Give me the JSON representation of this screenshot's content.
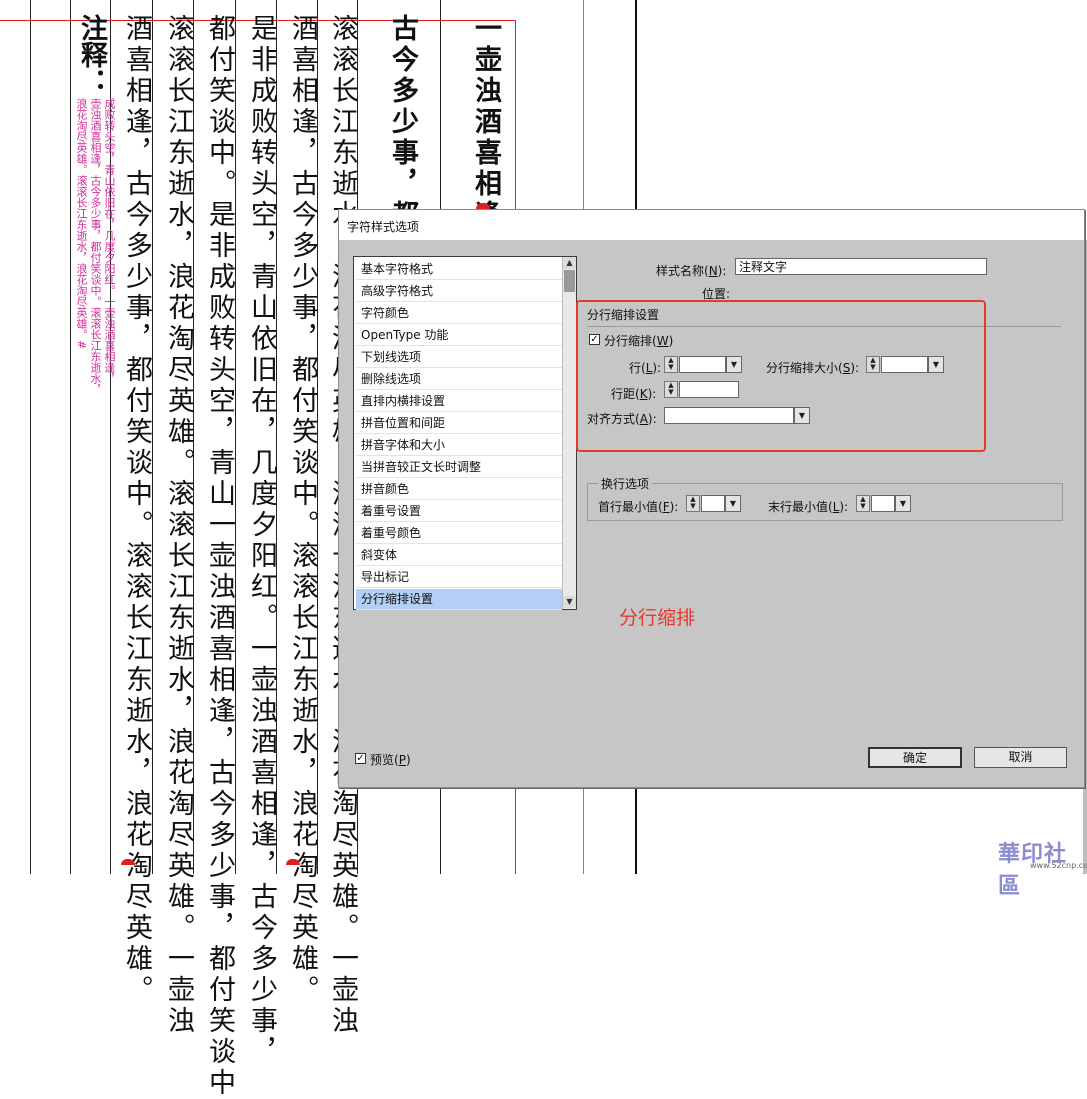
{
  "document": {
    "note_heading": "注释：",
    "note_text_col1": "成败转头空，青山依旧在，几度夕阳红。一壶浊酒喜相逢，",
    "note_text_col2": "壶浊酒喜相逢，古今多少事，都付笑谈中。滚滚长江东逝水，",
    "note_text_col3": "浪花淘尽英雄。滚滚长江东逝水，浪花淘尽英雄。#",
    "columns": [
      "酒喜相逢，古今多少事，都付笑谈中。滚滚长江东逝水，浪花淘尽英雄。",
      "滚滚长江东逝水，浪花淘尽英雄。滚滚长江东逝水，浪花淘尽英雄。一壶浊",
      "都付笑谈中。是非成败转头空，青山一壶浊酒喜相逢，古今多少事，都付笑谈中",
      "是非成败转头空，青山依旧在，几度夕阳红。一壶浊酒喜相逢，古今多少事，",
      "酒喜相逢，古今多少事，都付笑谈中。滚滚长江东逝水，浪花淘尽英雄。",
      "滚滚长江东逝水，浪花淘尽英雄。滚滚长江东逝水，浪花淘尽英雄。一壶浊"
    ],
    "bold_col1": "古今多少事，都付",
    "bold_col2": "一壶浊酒喜相逢，"
  },
  "dialog": {
    "title": "字符样式选项",
    "categories": [
      {
        "label": "基本字符格式"
      },
      {
        "label": "高级字符格式"
      },
      {
        "label": "字符颜色"
      },
      {
        "label": "OpenType 功能"
      },
      {
        "label": "下划线选项"
      },
      {
        "label": "删除线选项"
      },
      {
        "label": "直排内横排设置"
      },
      {
        "label": "拼音位置和间距"
      },
      {
        "label": "拼音字体和大小"
      },
      {
        "label": "当拼音较正文长时调整"
      },
      {
        "label": "拼音颜色"
      },
      {
        "label": "着重号设置"
      },
      {
        "label": "着重号颜色"
      },
      {
        "label": "斜变体"
      },
      {
        "label": "导出标记"
      },
      {
        "label": "分行缩排设置"
      }
    ],
    "selected_category": "分行缩排设置",
    "style_name_label": "样式名称(",
    "style_name_key": "N",
    "style_name_label_end": "):",
    "style_name_value": "注释文字",
    "position_label": "位置:",
    "section_title": "分行缩排设置",
    "warichu_checkbox": {
      "label": "分行缩排(",
      "key": "W",
      "end": ")",
      "checked": true
    },
    "lines_label": "行(",
    "lines_key": "L",
    "lines_end": "):",
    "lines_value": "",
    "size_label": "分行缩排大小(",
    "size_key": "S",
    "size_end": "):",
    "size_value": "",
    "leading_label": "行距(",
    "leading_key": "K",
    "leading_end": "):",
    "leading_value": "",
    "align_label": "对齐方式(",
    "align_key": "A",
    "align_end": "):",
    "align_value": "",
    "line_break_group": "换行选项",
    "first_min_label": "首行最小值(",
    "first_min_key": "F",
    "first_min_end": "):",
    "last_min_label": "末行最小值(",
    "last_min_key": "L",
    "last_min_end": "):",
    "preview_label": "预览(",
    "preview_key": "P",
    "preview_end": ")",
    "preview_checked": true,
    "ok_label": "确定",
    "cancel_label": "取消"
  },
  "annotation_text": "分行缩排",
  "watermark": {
    "text": "華印社區",
    "url": "www.52cnp.com"
  },
  "colors": {
    "annotation_red": "#e53b2c",
    "note_magenta": "#d0309a",
    "selection_blue": "#b4cff5",
    "dialog_gray": "#c6c6c6"
  }
}
